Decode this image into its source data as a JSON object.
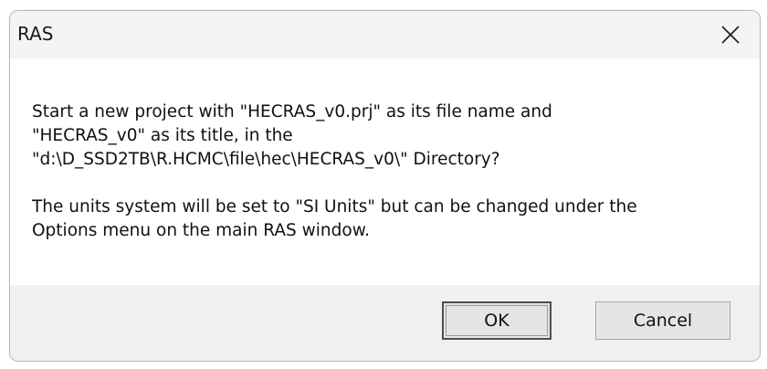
{
  "window": {
    "title": "RAS",
    "close_icon": "close-icon"
  },
  "message": {
    "line1": "Start a new project with \"HECRAS_v0.prj\" as its file name and",
    "line2": "\"HECRAS_v0\" as its title, in the",
    "line3": "\"d:\\D_SSD2TB\\R.HCMC\\file\\hec\\HECRAS_v0\\\" Directory?",
    "line4": "The units system will be set to \"SI Units\" but can be changed under the",
    "line5": "Options menu on the main RAS window."
  },
  "buttons": {
    "ok_label": "OK",
    "cancel_label": "Cancel"
  },
  "colors": {
    "titlebar_bg": "#f4f4f4",
    "footer_bg": "#f0f0f0",
    "button_bg": "#e5e5e5"
  }
}
